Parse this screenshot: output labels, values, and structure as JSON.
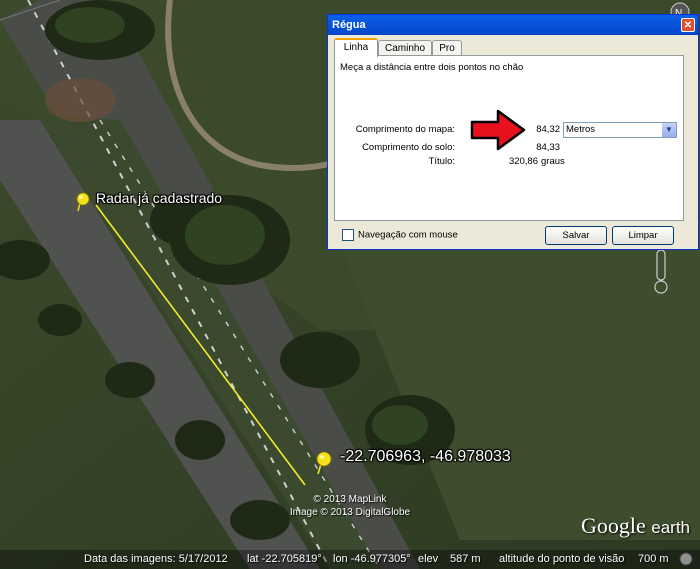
{
  "map": {
    "pin1_label": "Radar já cadastrado",
    "pin2_label": "-22.706963, -46.978033",
    "copyright_line1": "© 2013 MapLink",
    "copyright_line2": "Image © 2013 DigitalGlobe",
    "logo_google": "Google",
    "logo_earth": "earth",
    "ruler_color": "#f5ea2a",
    "pin_color": "#f2e21b"
  },
  "statusbar": {
    "imagery_date": "Data das imagens: 5/17/2012",
    "lat": "lat -22.705819°",
    "lon": "lon -46.977305°",
    "elev_label": "elev",
    "elev_value": "587 m",
    "eye_alt_label": "altitude do ponto de visão",
    "eye_alt_value": "700 m"
  },
  "dialog": {
    "title": "Régua",
    "close_icon": "close-icon",
    "tabs": [
      {
        "label": "Linha",
        "active": true
      },
      {
        "label": "Caminho",
        "active": false
      },
      {
        "label": "Pro",
        "active": false
      }
    ],
    "description": "Meça a distância entre dois pontos no chão",
    "map_length_label": "Comprimento do mapa:",
    "map_length_value": "84,32",
    "unit_selected": "Metros",
    "ground_length_label": "Comprimento do solo:",
    "ground_length_value": "84,33",
    "heading_label": "Título:",
    "heading_value": "320,86",
    "heading_unit": "graus",
    "mouse_nav_label": "Navegação com mouse",
    "mouse_nav_checked": false,
    "save_button": "Salvar",
    "clear_button": "Limpar",
    "arrow_color": "#e8101f"
  }
}
